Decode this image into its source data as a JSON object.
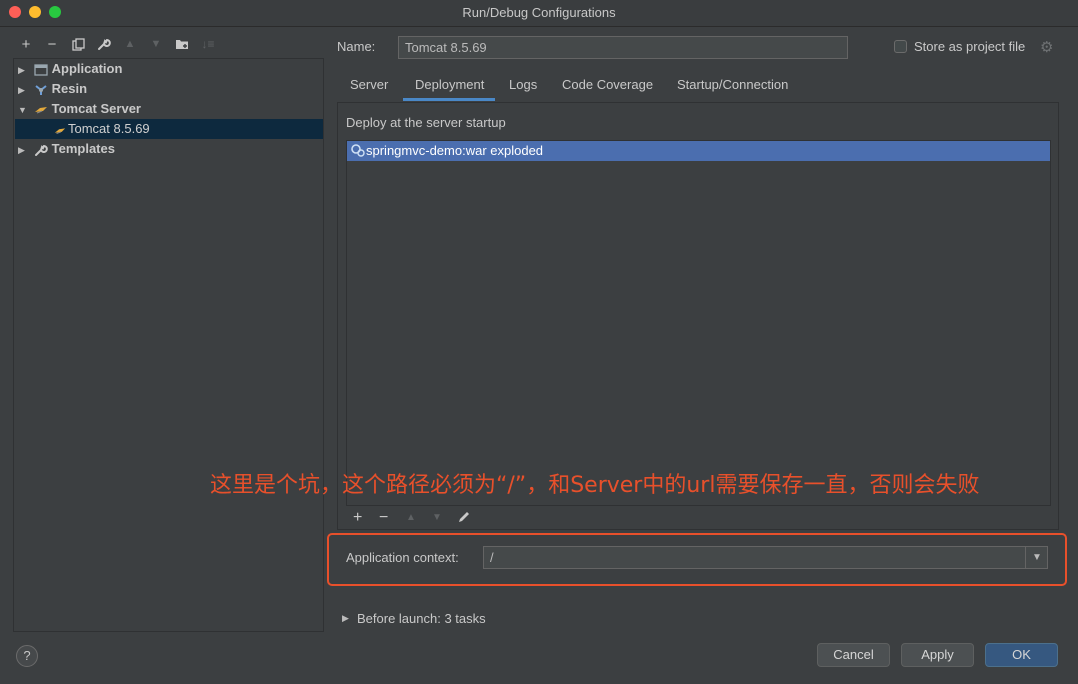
{
  "window": {
    "title": "Run/Debug Configurations"
  },
  "tree": {
    "items": [
      {
        "label": "Application",
        "icon": "application-icon",
        "expanded": false
      },
      {
        "label": "Resin",
        "icon": "resin-icon",
        "expanded": false
      },
      {
        "label": "Tomcat Server",
        "icon": "tomcat-icon",
        "expanded": true
      },
      {
        "label": "Tomcat 8.5.69",
        "icon": "tomcat-icon",
        "selected": true
      },
      {
        "label": "Templates",
        "icon": "wrench-icon",
        "expanded": false
      }
    ]
  },
  "form": {
    "name_label": "Name:",
    "name_value": "Tomcat 8.5.69",
    "store_label": "Store as project file"
  },
  "tabs": [
    {
      "label": "Server"
    },
    {
      "label": "Deployment",
      "active": true
    },
    {
      "label": "Logs"
    },
    {
      "label": "Code Coverage"
    },
    {
      "label": "Startup/Connection"
    }
  ],
  "deployment": {
    "heading": "Deploy at the server startup",
    "items": [
      "springmvc-demo:war exploded"
    ],
    "context_label": "Application context:",
    "context_value": "/"
  },
  "annotation": "这里是个坑，这个路径必须为“/”，和Server中的url需要保存一直，否则会失败",
  "before_launch": "Before launch: 3 tasks",
  "buttons": {
    "help": "?",
    "cancel": "Cancel",
    "apply": "Apply",
    "ok": "OK"
  },
  "colors": {
    "accent": "#4a88c7",
    "selection": "#4b6eaf",
    "annotation": "#e8502b",
    "ok_button": "#365880"
  }
}
